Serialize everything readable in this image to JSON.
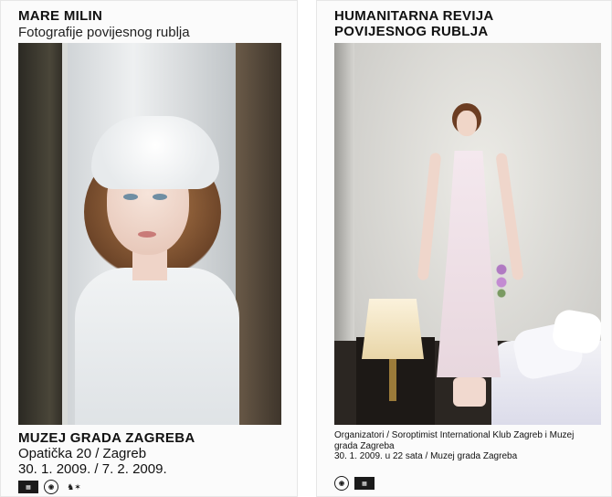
{
  "left_poster": {
    "artist": "MARE MILIN",
    "subtitle": "Fotografije povijesnog rublja",
    "venue": "MUZEJ GRADA ZAGREBA",
    "address": "Opatička 20 / Zagreb",
    "dates": "30. 1. 2009. / 7. 2. 2009.",
    "logos": [
      "museum-logo",
      "circle-logo",
      "crest-logo"
    ]
  },
  "right_poster": {
    "title_line1": "HUMANITARNA REVIJA",
    "title_line2": "POVIJESNOG RUBLJA",
    "organizers": "Organizatori / Soroptimist International Klub Zagreb i Muzej grada Zagreba",
    "date_time": "30. 1. 2009. u 22 sata / Muzej grada Zagreba",
    "logos": [
      "circle-logo",
      "museum-logo"
    ]
  }
}
